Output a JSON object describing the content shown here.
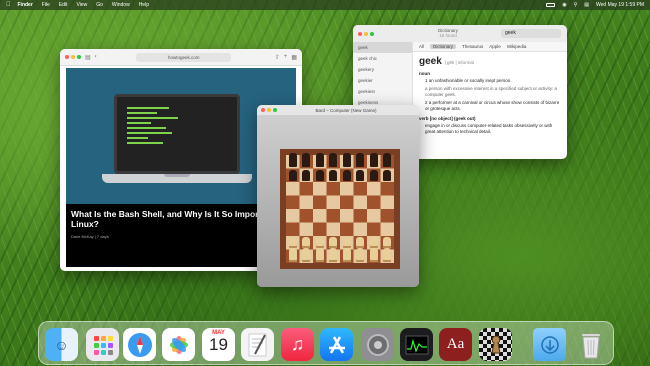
{
  "menubar": {
    "apple_icon": "apple-icon",
    "app_name": "Finder",
    "menus": [
      "File",
      "Edit",
      "View",
      "Go",
      "Window",
      "Help"
    ],
    "clock": "Wed May 19  1:59 PM"
  },
  "safari": {
    "url": "howtogeek.com",
    "headline": "What Is the Bash Shell, and Why Is It So Important to Linux?",
    "byline": "Dave McKay  |  7 days"
  },
  "dictionary": {
    "title": "Dictionary",
    "subtitle": "15 found",
    "search_value": "geek",
    "tabs": [
      "All",
      "Dictionary",
      "Thesaurus",
      "Apple",
      "Wikipedia"
    ],
    "sidebar": [
      "geek",
      "geek chic",
      "geekery",
      "geekier",
      "geekiest",
      "geekiness",
      "geeky"
    ],
    "entry": {
      "word": "geek",
      "pron": "| gēk | informal",
      "pos1": "noun",
      "def1": "1 an unfashionable or socially inept person.",
      "def1b": "a person with excessive interest in a specified subject or activity: a computer geek.",
      "def2": "2 a performer at a carnival or circus whose show consists of bizarre or grotesque acts.",
      "pos2": "verb  [no object] (geek out)",
      "def3": "engage in or discuss computer-related tasks obsessively or with great attention to technical detail."
    }
  },
  "chess": {
    "title": "Bard – Computer   (New Game)"
  },
  "dock": {
    "calendar_month": "MAY",
    "calendar_day": "19",
    "dictionary_label": "Aa"
  }
}
